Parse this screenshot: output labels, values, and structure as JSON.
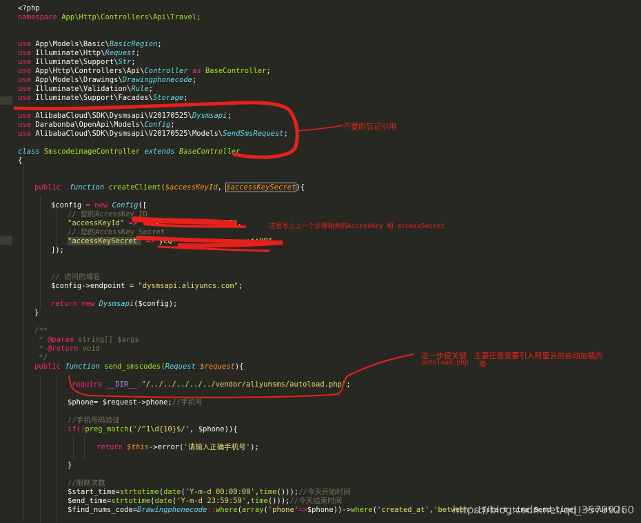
{
  "editor": {
    "lines": {
      "l1": "<?php",
      "l2_kw": "namespace",
      "l2_ns": " App\\Http\\Controllers\\Api\\Travel;",
      "u1_a": " App\\Models\\Basic\\",
      "u1_b": "BasicRegion",
      "u1_c": ";",
      "u2_a": " Illuminate\\Http\\",
      "u2_b": "Request",
      "u2_c": ";",
      "u3_a": " Illuminate\\Support\\",
      "u3_b": "Str",
      "u3_c": ";",
      "u4_a": " App\\Http\\Controllers\\Api\\",
      "u4_b": "Controller",
      "u4_as": " as ",
      "u4_c": "BaseController",
      "u4_d": ";",
      "u5_a": " App\\Models\\Drawings\\",
      "u5_b": "Drawingphonecode",
      "u5_c": ";",
      "u6_a": " Illuminate\\Validation\\",
      "u6_b": "Rule",
      "u6_c": ";",
      "u7_a": " Illuminate\\Support\\Facades\\",
      "u7_b": "Storage",
      "u7_c": ";",
      "u8_a": " AlibabaCloud\\SDK\\Dysmsapi\\V20170525\\",
      "u8_b": "Dysmsapi",
      "u8_c": ";",
      "u9_a": " Darabonba\\OpenApi\\Models\\",
      "u9_b": "Config",
      "u9_c": ";",
      "u10_a": " AlibabaCloud\\SDK\\Dysmsapi\\V20170525\\Models\\",
      "u10_b": "SendSmsRequest",
      "u10_c": ";",
      "use_kw": "use",
      "class_kw": "class",
      "class_name": " SmscodeimageController ",
      "extends_kw": "extends",
      "base": " BaseController",
      "brace_open": "{",
      "public_kw": "public",
      "function_kw": "function",
      "createClient": " createClient(",
      "p_keyid": "$accessKeyId",
      "comma": ", ",
      "p_secret": "$accessKeySecret",
      "close_brace_paren": "){",
      "config_var": "$config",
      "eq": " = ",
      "new_kw": "new",
      "config_cls": " Config",
      "open_arr": "([",
      "cmt_id": "// 您的AccessKey ID",
      "key_id": "\"accessKeyId\"",
      "arrow": " => ",
      "val_id": "\"LTA••••••••••••••iSE\",",
      "cmt_secret": "// 您的AccessKey Secret",
      "key_secret": "\"accessKeySecret\"",
      "arrow2": " =>",
      "val_secret": "\"yCQ••••••••••••••••••iiU9\"",
      "close_arr": "]);",
      "cmt_endpoint": "// 访问的域名",
      "endpoint_a": "$config->endpoint = ",
      "endpoint_b": "\"dysmsapi.aliyuncs.com\"",
      "endpoint_c": ";",
      "return_kw": "return",
      "dys_cls": "Dysmsapi",
      "ret_tail": "($config);",
      "brace_close": "}",
      "doc1": "/**",
      "doc2_a": " * ",
      "doc2_b": "@param",
      "doc2_c": " string[] $args",
      "doc3_a": " * ",
      "doc3_b": "@return",
      "doc3_c": " void",
      "doc4": " */",
      "send_fn": " send_smscodes(",
      "req_cls": "Request",
      "req_var": " $request",
      "send_tail": "){",
      "require_kw": "require",
      "dir_const": " __DIR__",
      "dot": ".",
      "req_path": "\"/../../../../../vendor/aliyunsms/autoload.php\"",
      "semi": ";",
      "phone_line_a": "$phone= $request->phone;",
      "phone_line_b": "//手机号",
      "cmt_verify": "//手机号码验证",
      "if_kw": "if",
      "if_a": "(!",
      "preg": "preg_match",
      "if_b": "(",
      "regex": "'/^1\\d{10}$/'",
      "if_c": ", $phone)){",
      "ret_this": "$this",
      "ret_err_a": "->error(",
      "ret_err_str": "'请输入正确手机号'",
      "ret_err_b": ");",
      "cmt_limit": "//限制次数",
      "st_a": "$start_time=",
      "st_fn": "strtotime",
      "st_b": "(",
      "st_date": "date",
      "st_c": "(",
      "st_str": "'Y-m-d 00:00:00'",
      "st_d": ",",
      "st_time": "time",
      "st_e": "()));",
      "st_cmt": "//今天开始时间",
      "et_a": "$end_time=",
      "et_str": "'Y-m-d 23:59:59'",
      "et_cmt": "//今天结束时间",
      "fn_a": "$find_nums_code=",
      "fn_cls": "Drawingphonecode",
      "fn_b": "::",
      "fn_where": "where",
      "fn_c": "(",
      "fn_array": "array",
      "fn_d": "(",
      "fn_phone": "'phone'",
      "fn_e": "=>",
      "fn_f": "$phone))->",
      "fn_g": "(",
      "fn_created": "'created_at'",
      "fn_h": ",",
      "fn_between": "'between'",
      "fn_i": ",[$start_time,$end_time])->count();"
    }
  },
  "annotations": {
    "a1": "不要的忘记引用",
    "a2": "这里写上上一个步骤相关的AccessKey 和 accessSecret",
    "a3_line1": "这一步很关键   主要还是需要引入阿里云的自动加载的",
    "a3_line2a": "autoload.php",
    "a3_line2b": "类"
  },
  "watermark": "https://blog.csdn.net/qq_35799260",
  "colors": {
    "background": "#272822",
    "keyword": "#f92672",
    "function": "#a6e22e",
    "class": "#66d9ef",
    "string": "#e6db74",
    "comment": "#75715e",
    "param": "#fd971f",
    "annotation": "#e8201c"
  }
}
